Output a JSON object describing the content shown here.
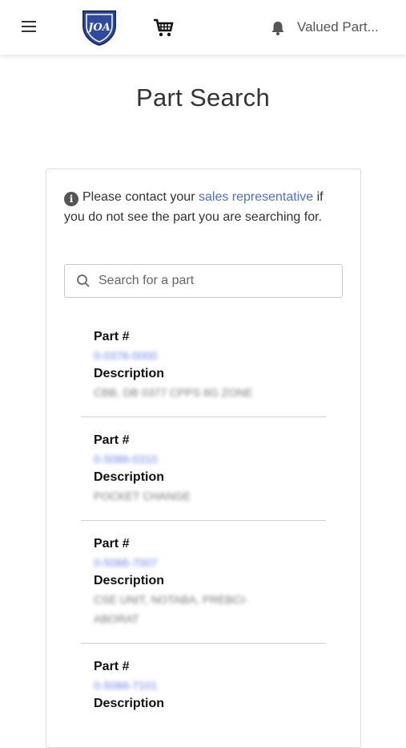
{
  "header": {
    "user_name": "Valued Part...",
    "logo_text": "JOA",
    "icons": {
      "menu": "hamburger-icon",
      "cart": "cart-icon",
      "notifications": "bell-icon"
    }
  },
  "page": {
    "title": "Part Search"
  },
  "notice": {
    "text_before": "Please contact your",
    "link_text": "sales representative",
    "text_after": "if you do not see the part you are searching for."
  },
  "search": {
    "placeholder": "Search for a part",
    "value": ""
  },
  "parts_list": {
    "part_label": "Part #",
    "description_label": "Description",
    "items": [
      {
        "part_number": "0-0376-0000",
        "description": "CBB, DB 0377 CPPS 8G ZONE"
      },
      {
        "part_number": "0-5088-0310",
        "description": "POCKET CHANGE"
      },
      {
        "part_number": "0-5086-7007",
        "description": "CSE UNIT, NOTABA, PREBCI-",
        "description_2": "ABORAT"
      },
      {
        "part_number": "0-5088-7101",
        "description": ""
      }
    ]
  },
  "colors": {
    "link": "#4a6fd8",
    "logo_blue": "#2e4a9e"
  }
}
